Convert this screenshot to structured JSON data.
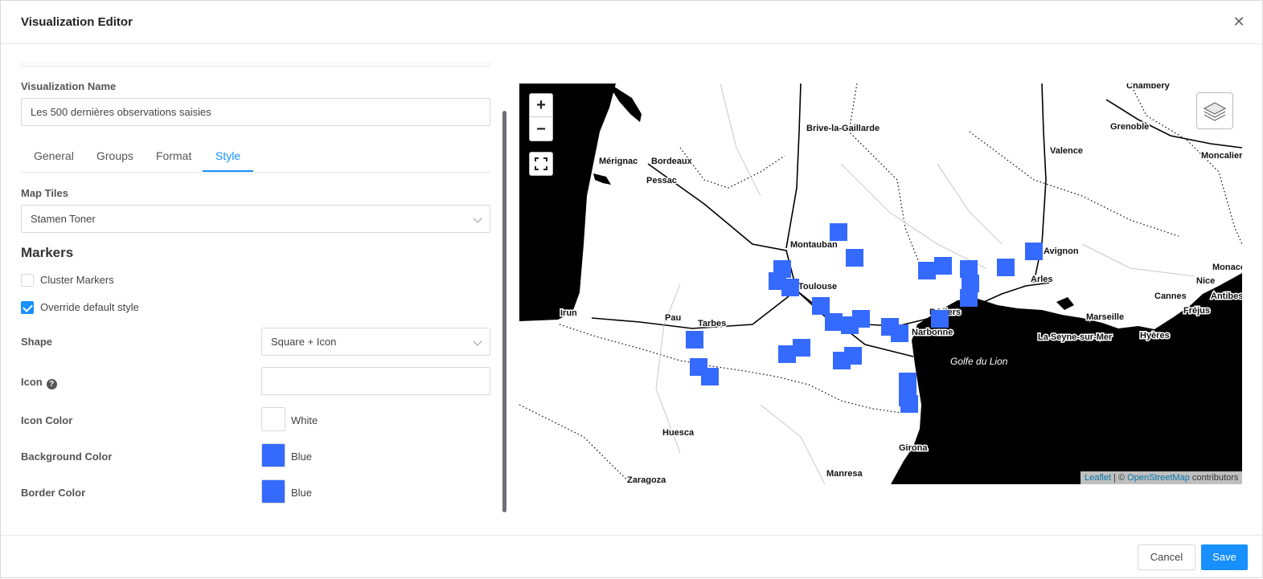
{
  "header": {
    "title": "Visualization Editor"
  },
  "form": {
    "name_label": "Visualization Name",
    "name_value": "Les 500 dernières observations saisies",
    "tabs": [
      {
        "label": "General"
      },
      {
        "label": "Groups"
      },
      {
        "label": "Format"
      },
      {
        "label": "Style",
        "active": true
      }
    ],
    "map_tiles_label": "Map Tiles",
    "map_tiles_value": "Stamen Toner",
    "markers_title": "Markers",
    "cluster_label": "Cluster Markers",
    "cluster_checked": false,
    "override_label": "Override default style",
    "override_checked": true,
    "shape_label": "Shape",
    "shape_value": "Square + Icon",
    "icon_label": "Icon",
    "icon_value": "",
    "icon_color_label": "Icon Color",
    "icon_color_name": "White",
    "icon_color_hex": "#ffffff",
    "bg_color_label": "Background Color",
    "bg_color_name": "Blue",
    "bg_color_hex": "#356aff",
    "border_color_label": "Border Color",
    "border_color_name": "Blue",
    "border_color_hex": "#356aff"
  },
  "map": {
    "zoom_in": "+",
    "zoom_out": "−",
    "attribution_leaflet": "Leaflet",
    "attribution_sep": " | © ",
    "attribution_osm": "OpenStreetMap",
    "attribution_contrib": " contributors",
    "sea_label": "Golfe du Lion",
    "cities": [
      "Chambéry",
      "Brive-la-Gaillarde",
      "Grenoble",
      "Valence",
      "Moncalieri",
      "Mérignac",
      "Bordeaux",
      "Pessac",
      "Montauban",
      "Avignon",
      "Monaco",
      "Toulouse",
      "Arles",
      "Nice",
      "Cannes",
      "Antibes",
      "Irun",
      "Pau",
      "Béziers",
      "Marseille",
      "Fréjus",
      "Tarbes",
      "Narbonne",
      "La Seyne-sur-Mer",
      "Hyères",
      "Huesca",
      "Girona",
      "Manresa",
      "Zaragoza"
    ],
    "marker_color": "#356aff"
  },
  "footer": {
    "cancel_label": "Cancel",
    "save_label": "Save"
  }
}
